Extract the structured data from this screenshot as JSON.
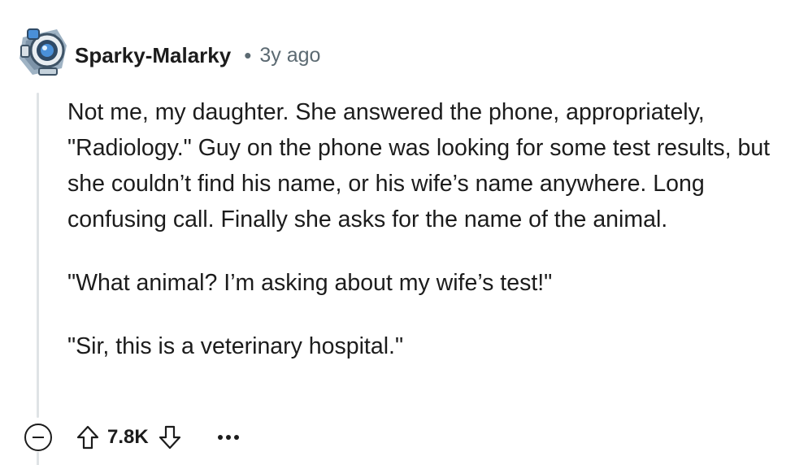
{
  "comment": {
    "username": "Sparky-Malarky",
    "separator": "•",
    "timestamp": "3y ago",
    "avatar_icon": "robot-avatar-icon",
    "paragraphs": [
      "Not me, my daughter. She answered the phone, appropriately, \"Radiology.\" Guy on the phone was looking for some test results, but she couldn’t find his name, or his wife’s name anywhere. Long confusing call. Finally she asks for the name of the animal.",
      "\"What animal? I’m asking about my wife’s test!\"",
      "\"Sir, this is a veterinary hospital.\""
    ]
  },
  "actions": {
    "collapse_icon": "minus-circle-icon",
    "upvote_icon": "arrow-up-icon",
    "score": "7.8K",
    "downvote_icon": "arrow-down-icon",
    "more_icon": "more-horizontal-icon"
  },
  "colors": {
    "text": "#1c1c1c",
    "meta": "#5c6a72",
    "thread_line": "#dfe3e6"
  }
}
